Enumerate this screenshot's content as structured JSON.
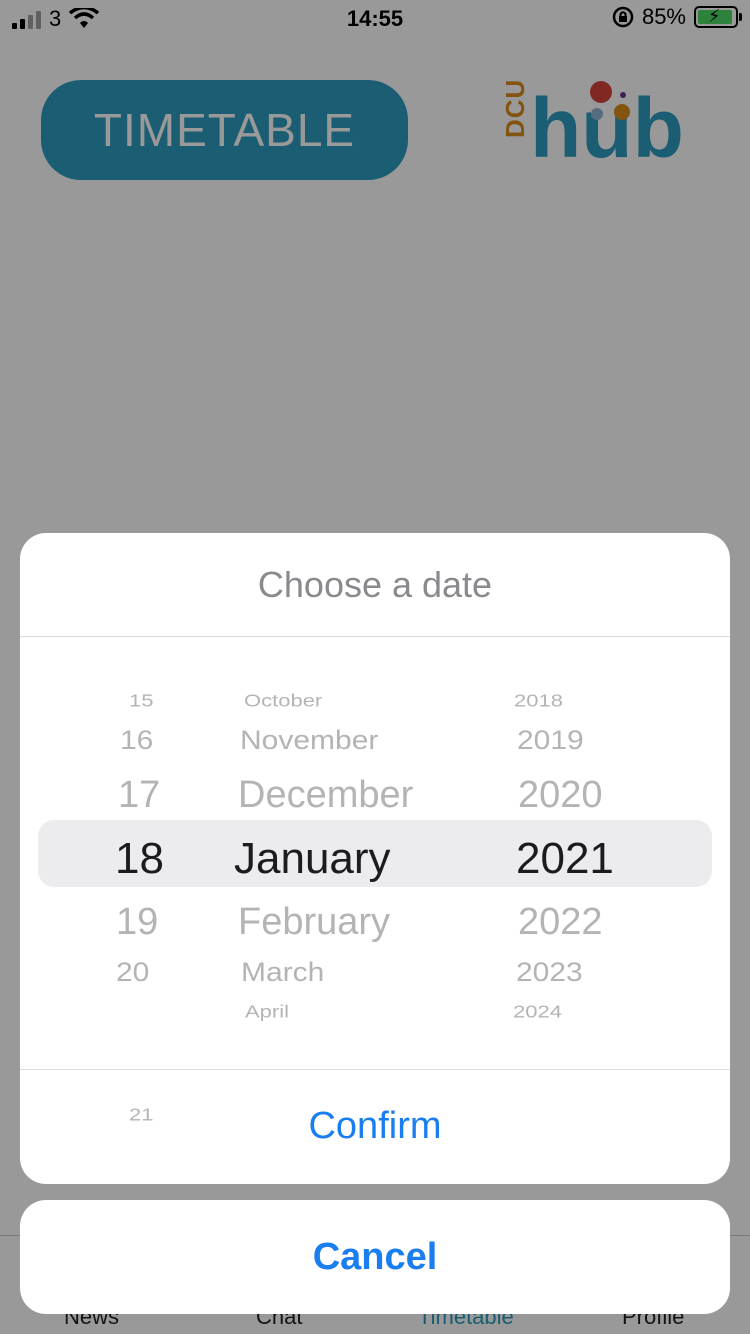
{
  "status_bar": {
    "carrier": "3",
    "time": "14:55",
    "battery_percent": "85%"
  },
  "header": {
    "timetable_button_label": "TIMETABLE",
    "logo_small_text": "DCU",
    "logo_main_text": "hub"
  },
  "background": {
    "partial_text": "",
    "tabs": [
      {
        "label": "News"
      },
      {
        "label": "Chat"
      },
      {
        "label": "Timetable"
      },
      {
        "label": "Profile"
      }
    ]
  },
  "date_picker": {
    "title": "Choose a date",
    "days": [
      "15",
      "16",
      "17",
      "18",
      "19",
      "20",
      "21"
    ],
    "months": [
      "October",
      "November",
      "December",
      "January",
      "February",
      "March",
      "April"
    ],
    "years": [
      "2018",
      "2019",
      "2020",
      "2021",
      "2022",
      "2023",
      "2024"
    ],
    "selected": {
      "day": "18",
      "month": "January",
      "year": "2021"
    },
    "confirm_label": "Confirm",
    "cancel_label": "Cancel"
  },
  "colors": {
    "accent": "#1a7ef0",
    "brand_teal": "#2e9cbf",
    "brand_orange": "#d98c1a"
  }
}
